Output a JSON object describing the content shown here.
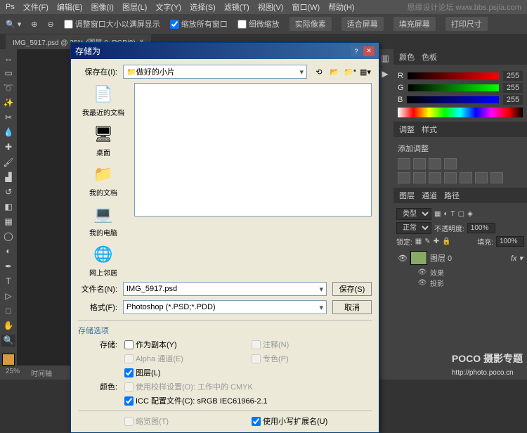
{
  "menubar": [
    "文件(F)",
    "编辑(E)",
    "图像(I)",
    "图层(L)",
    "文字(Y)",
    "选择(S)",
    "滤镜(T)",
    "视图(V)",
    "窗口(W)",
    "帮助(H)"
  ],
  "options": {
    "chk1": "调整窗口大小以满屏显示",
    "chk2": "缩放所有窗口",
    "chk3": "细微缩放",
    "btn1": "实际像素",
    "btn2": "适合屏幕",
    "btn3": "填充屏幕",
    "btn4": "打印尺寸"
  },
  "doc_tab": "IMG_5917.psd @ 25% (图层 0, RGB/8)",
  "status": {
    "zoom": "25%",
    "label": "时间轴"
  },
  "color": {
    "tab1": "颜色",
    "tab2": "色板",
    "r_label": "R",
    "r_val": "255",
    "g_label": "G",
    "g_val": "255",
    "b_label": "B",
    "b_val": "255"
  },
  "adjust": {
    "tab1": "调整",
    "tab2": "样式",
    "title": "添加调整"
  },
  "layers": {
    "tab1": "图层",
    "tab2": "通道",
    "tab3": "路径",
    "kind": "类型",
    "blend": "正常",
    "opacity_label": "不透明度:",
    "opacity": "100%",
    "lock_label": "锁定:",
    "fill_label": "填充:",
    "fill": "100%",
    "items": [
      {
        "name": "图层 0",
        "fx": true
      },
      {
        "name": "效果",
        "indent": 1
      },
      {
        "name": "投影",
        "indent": 1
      }
    ]
  },
  "dialog": {
    "title": "存储为",
    "save_in_label": "保存在(I):",
    "save_in_value": "做好的小片",
    "places": [
      {
        "icon": "📄",
        "label": "我最近的文档"
      },
      {
        "icon": "🖥",
        "label": "桌面"
      },
      {
        "icon": "📁",
        "label": "我的文档"
      },
      {
        "icon": "💻",
        "label": "我的电脑"
      },
      {
        "icon": "🌐",
        "label": "网上邻居"
      }
    ],
    "filename_label": "文件名(N):",
    "filename": "IMG_5917.psd",
    "format_label": "格式(F):",
    "format": "Photoshop (*.PSD;*.PDD)",
    "save_btn": "保存(S)",
    "cancel_btn": "取消",
    "opts_title": "存储选项",
    "store_label": "存储:",
    "as_copy": "作为副本(Y)",
    "notes": "注释(N)",
    "alpha": "Alpha 通道(E)",
    "spot": "专色(P)",
    "layers_ck": "图层(L)",
    "color_label": "颜色:",
    "proof": "使用校样设置(O): 工作中的 CMYK",
    "icc": "ICC 配置文件(C): sRGB IEC61966-2.1",
    "thumb": "缩览图(T)",
    "lowercase": "使用小写扩展名(U)"
  },
  "watermark1": "思缘设计论坛  www.bbs.psjia.com",
  "watermark2": "POCO 摄影专题",
  "watermark2_sub": "http://photo.poco.cn"
}
